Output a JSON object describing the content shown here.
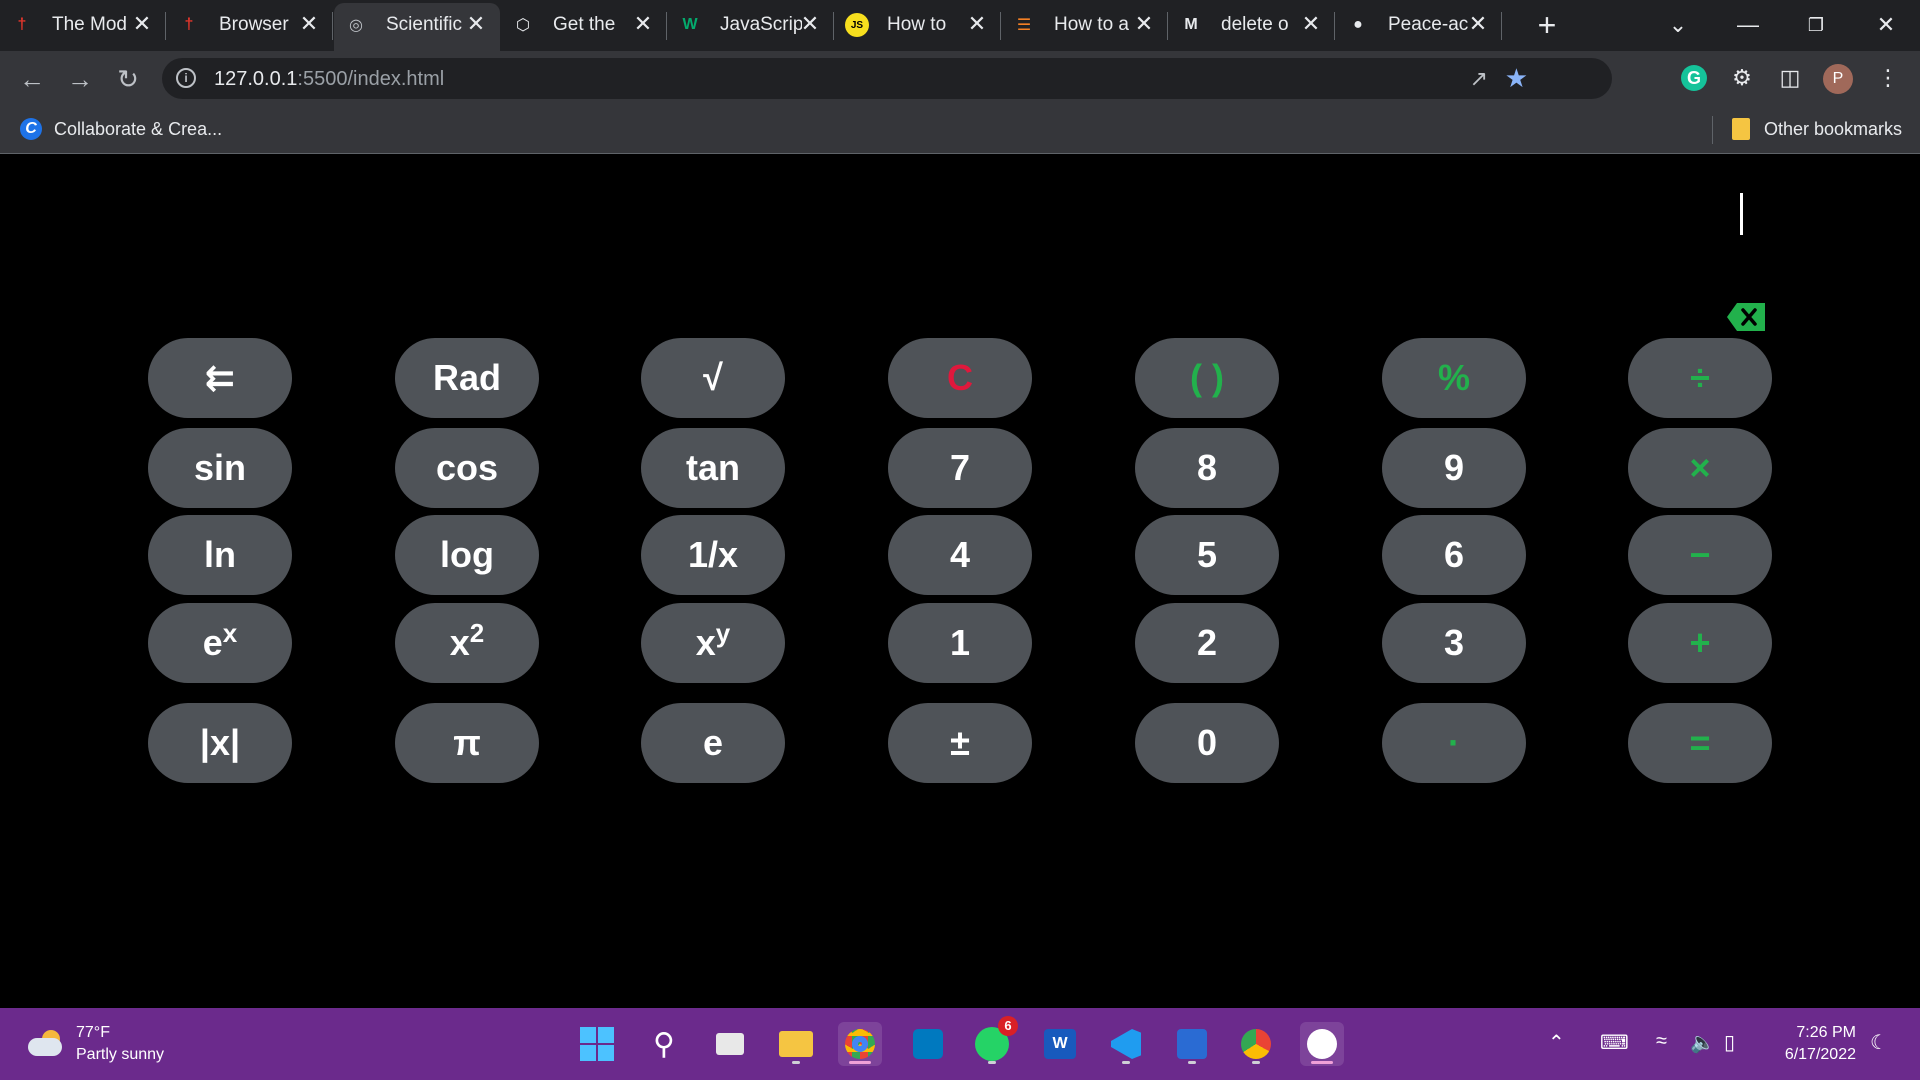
{
  "tabs": [
    {
      "title": "The Mod",
      "icon": "figure-icon"
    },
    {
      "title": "Browser",
      "icon": "figure-icon"
    },
    {
      "title": "Scientific",
      "icon": "globe-icon",
      "active": true
    },
    {
      "title": "Get the",
      "icon": "cube-icon"
    },
    {
      "title": "JavaScrip",
      "icon": "w3-icon"
    },
    {
      "title": "How to",
      "icon": "js-icon"
    },
    {
      "title": "How to a",
      "icon": "stackoverflow-icon"
    },
    {
      "title": "delete o",
      "icon": "medium-icon"
    },
    {
      "title": "Peace-ac",
      "icon": "github-icon"
    }
  ],
  "address": {
    "host": "127.0.0.1",
    "path": ":5500/index.html"
  },
  "bookmarks": {
    "first": "Collaborate & Crea...",
    "other": "Other bookmarks"
  },
  "profile_initial": "P",
  "calculator": {
    "display": "",
    "rows": [
      [
        {
          "label": "⇇",
          "name": "toggle-button",
          "color": "white"
        },
        {
          "label": "Rad",
          "name": "rad-button",
          "color": "white"
        },
        {
          "label": "√",
          "name": "sqrt-button",
          "color": "white"
        },
        {
          "label": "C",
          "name": "clear-button",
          "color": "red"
        },
        {
          "label": "( )",
          "name": "parentheses-button",
          "color": "green"
        },
        {
          "label": "%",
          "name": "percent-button",
          "color": "green"
        },
        {
          "label": "÷",
          "name": "divide-button",
          "color": "green"
        }
      ],
      [
        {
          "label": "sin",
          "name": "sin-button",
          "color": "white"
        },
        {
          "label": "cos",
          "name": "cos-button",
          "color": "white"
        },
        {
          "label": "tan",
          "name": "tan-button",
          "color": "white"
        },
        {
          "label": "7",
          "name": "digit-7-button",
          "color": "white"
        },
        {
          "label": "8",
          "name": "digit-8-button",
          "color": "white"
        },
        {
          "label": "9",
          "name": "digit-9-button",
          "color": "white"
        },
        {
          "label": "×",
          "name": "multiply-button",
          "color": "green"
        }
      ],
      [
        {
          "label": "ln",
          "name": "ln-button",
          "color": "white"
        },
        {
          "label": "log",
          "name": "log-button",
          "color": "white"
        },
        {
          "label": "1/x",
          "name": "reciprocal-button",
          "color": "white"
        },
        {
          "label": "4",
          "name": "digit-4-button",
          "color": "white"
        },
        {
          "label": "5",
          "name": "digit-5-button",
          "color": "white"
        },
        {
          "label": "6",
          "name": "digit-6-button",
          "color": "white"
        },
        {
          "label": "−",
          "name": "subtract-button",
          "color": "green"
        }
      ],
      [
        {
          "label": "e",
          "sup": "x",
          "name": "exp-button",
          "color": "white"
        },
        {
          "label": "x",
          "sup": "2",
          "name": "square-button",
          "color": "white"
        },
        {
          "label": "x",
          "sup": "y",
          "name": "power-button",
          "color": "white"
        },
        {
          "label": "1",
          "name": "digit-1-button",
          "color": "white"
        },
        {
          "label": "2",
          "name": "digit-2-button",
          "color": "white"
        },
        {
          "label": "3",
          "name": "digit-3-button",
          "color": "white"
        },
        {
          "label": "+",
          "name": "add-button",
          "color": "green"
        }
      ],
      [
        {
          "label": "|x|",
          "name": "abs-button",
          "color": "white"
        },
        {
          "label": "π",
          "name": "pi-button",
          "color": "white"
        },
        {
          "label": "e",
          "name": "euler-button",
          "color": "white"
        },
        {
          "label": "±",
          "name": "negate-button",
          "color": "white"
        },
        {
          "label": "0",
          "name": "digit-0-button",
          "color": "white"
        },
        {
          "label": "·",
          "name": "decimal-button",
          "color": "green"
        },
        {
          "label": "=",
          "name": "equals-button",
          "color": "green"
        }
      ]
    ]
  },
  "taskbar": {
    "weather_temp": "77°F",
    "weather_text": "Partly sunny",
    "whatsapp_badge": "6",
    "time": "7:26 PM",
    "date": "6/17/2022"
  }
}
